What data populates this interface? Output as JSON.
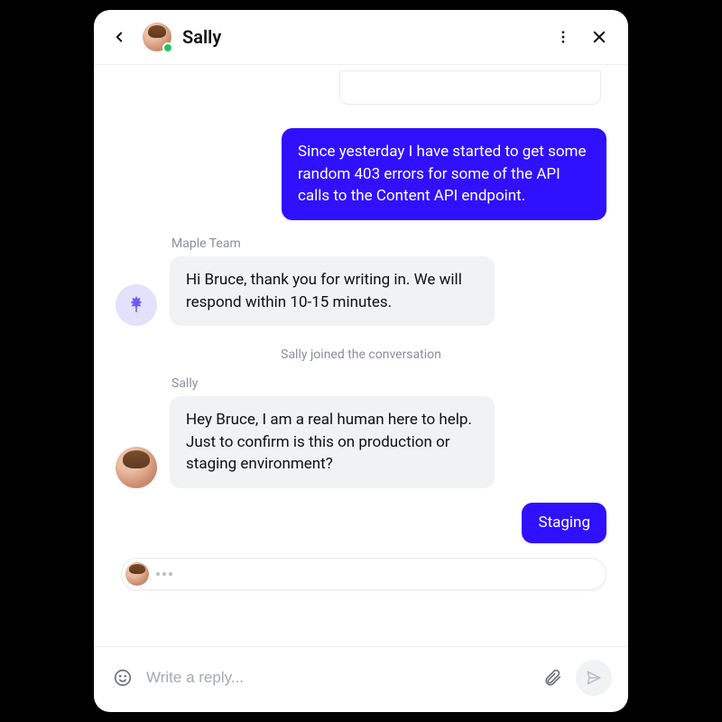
{
  "header": {
    "name": "Sally",
    "presence_color": "#22c55e"
  },
  "messages": [
    {
      "id": "m1",
      "side": "me",
      "text": "Since yesterday I have started to get some random 403 errors for some of the API calls to the Content API endpoint."
    },
    {
      "id": "m2",
      "side": "them",
      "sender": "Maple Team",
      "avatar": "maple",
      "text": "Hi Bruce, thank you for writing in. We will respond within 10-15 minutes."
    },
    {
      "id": "sys1",
      "system": true,
      "text": "Sally joined the conversation"
    },
    {
      "id": "m3",
      "side": "them",
      "sender": "Sally",
      "avatar": "sally",
      "text": "Hey Bruce, I am a real human here to help. Just to confirm is this on production or staging environment?"
    },
    {
      "id": "m4",
      "side": "me",
      "small": true,
      "text": "Staging"
    }
  ],
  "typing_indicator": {
    "who": "Sally"
  },
  "composer": {
    "placeholder": "Write a reply..."
  },
  "colors": {
    "accent": "#2f10ff",
    "bubble_them": "#f1f2f4",
    "text_muted": "#8b8f98"
  },
  "icons": {
    "back": "chevron-left",
    "more": "dots-vertical",
    "close": "x",
    "emoji": "smile",
    "attach": "paperclip",
    "send": "paper-plane",
    "maple": "maple-leaf"
  }
}
